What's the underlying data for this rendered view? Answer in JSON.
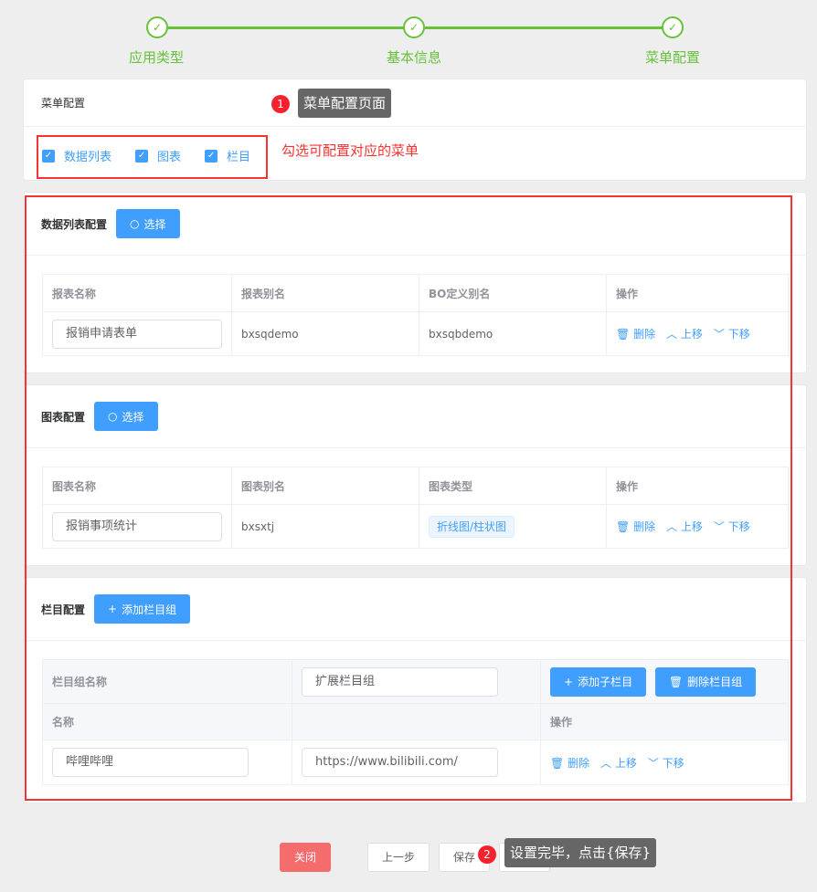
{
  "steps": [
    {
      "label": "应用类型"
    },
    {
      "label": "基本信息"
    },
    {
      "label": "菜单配置"
    }
  ],
  "menu_card": {
    "title": "菜单配置",
    "checkboxes": [
      "数据列表",
      "图表",
      "栏目"
    ]
  },
  "annotations": {
    "tip1_num": "1",
    "tip1": "菜单配置页面",
    "hint": "勾选可配置对应的菜单",
    "tip2_num": "2",
    "tip2": "设置完毕，点击{保存}"
  },
  "list_card": {
    "title": "数据列表配置",
    "select": "选择",
    "headers": [
      "报表名称",
      "报表别名",
      "BO定义别名",
      "操作"
    ],
    "row": {
      "name": "报销申请表单",
      "alias": "bxsqdemo",
      "bo": "bxsqbdemo"
    }
  },
  "chart_card": {
    "title": "图表配置",
    "select": "选择",
    "headers": [
      "图表名称",
      "图表别名",
      "图表类型",
      "操作"
    ],
    "row": {
      "name": "报销事项统计",
      "alias": "bxsxtj",
      "type": "折线图/柱状图"
    }
  },
  "column_card": {
    "title": "栏目配置",
    "add_group": "添加栏目组",
    "group_label": "栏目组名称",
    "group_name": "扩展栏目组",
    "add_child": "添加子栏目",
    "delete_group": "删除栏目组",
    "headers": [
      "名称",
      "",
      "操作"
    ],
    "row": {
      "name": "哔哩哔哩",
      "url": "https://www.bilibili.com/"
    }
  },
  "ops": {
    "delete": "删除",
    "up": "上移",
    "down": "下移"
  },
  "footer": {
    "close": "关闭",
    "prev": "上一步",
    "save": "保存"
  }
}
